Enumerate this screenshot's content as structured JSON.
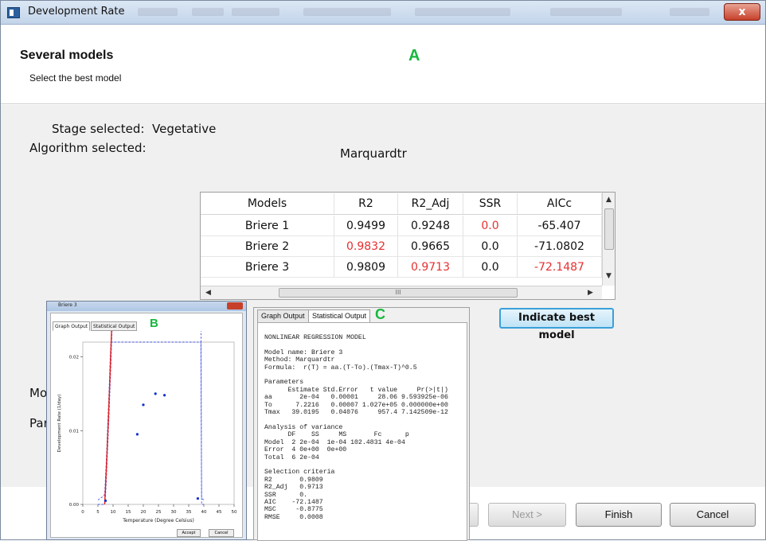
{
  "window": {
    "title": "Development Rate",
    "close_glyph": "x"
  },
  "header": {
    "title": "Several models",
    "subtitle": "Select the best model"
  },
  "markers": {
    "a": "A",
    "b": "B",
    "c": "C"
  },
  "stage": {
    "label": "Stage selected:",
    "value": "Vegetative"
  },
  "algorithm": {
    "label": "Algorithm selected:",
    "value": "Marquardtr"
  },
  "table": {
    "columns": [
      "Models",
      "R2",
      "R2_Adj",
      "SSR",
      "AICc"
    ],
    "rows": [
      {
        "model": "Briere 1",
        "r2": "0.9499",
        "r2_adj": "0.9248",
        "ssr": "0.0",
        "aicc": "-65.407"
      },
      {
        "model": "Briere 2",
        "r2": "0.9832",
        "r2_adj": "0.9665",
        "ssr": "0.0",
        "aicc": "-71.0802"
      },
      {
        "model": "Briere 3",
        "r2": "0.9809",
        "r2_adj": "0.9713",
        "ssr": "0.0",
        "aicc": "-72.1487"
      }
    ],
    "scroll_glyph": "III",
    "highlight_color": "#e53030"
  },
  "best_model_button": "Indicate best model",
  "left_labels": {
    "model": "Mo",
    "params": "Par"
  },
  "footer": {
    "next": "Next >",
    "finish": "Finish",
    "cancel": "Cancel"
  },
  "window_b": {
    "title": "Briere 3",
    "tabs": [
      "Graph Output",
      "Statistical Output"
    ],
    "accept": "Accept",
    "cancel": "Cancel",
    "chart_data": {
      "type": "scatter",
      "xlabel": "Temperature (Degree Celsius)",
      "ylabel": "Development Rate (1/day)",
      "x_ticks": [
        0,
        5,
        10,
        15,
        20,
        25,
        30,
        35,
        40,
        45,
        50
      ],
      "y_ticks": [
        "0.00",
        "0.01",
        "0.02"
      ],
      "xlim": [
        0,
        50
      ],
      "ylim": [
        0,
        0.022
      ],
      "points": [
        [
          7.5,
          0.0005
        ],
        [
          18,
          0.0095
        ],
        [
          20,
          0.0135
        ],
        [
          24,
          0.015
        ],
        [
          27,
          0.0148
        ],
        [
          38,
          0.0008
        ]
      ],
      "fit_curve": {
        "model": "Briere 3",
        "aa": 0.0002,
        "To": 7.2216,
        "Tmax": 39.0195,
        "color": "#e82020"
      },
      "ci_color": "#3f52e0",
      "point_color": "#1030d0"
    }
  },
  "window_c": {
    "tabs": [
      "Graph Output",
      "Statistical Output"
    ],
    "output": "NONLINEAR REGRESSION MODEL\n\nModel name: Briere 3\nMethod: Marquardtr\nFormula:  r(T) = aa.(T-To).(Tmax-T)^0.5\n\nParameters\n      Estimate Std.Error   t value     Pr(>|t|)\naa       2e-04   0.00001     28.06 9.593925e-06\nTo      7.2216   0.00007 1.027e+05 0.000000e+00\nTmax   39.0195   0.04076     957.4 7.142509e-12\n\nAnalysis of variance\n      DF    SS     MS       Fc      p\nModel  2 2e-04  1e-04 102.4831 4e-04\nError  4 0e+00  0e+00\nTotal  6 2e-04\n\nSelection criteria\nR2       0.9809\nR2_Adj   0.9713\nSSR      0.\nAIC    -72.1487\nMSC     -0.8775\nRMSE     0.0008"
  }
}
